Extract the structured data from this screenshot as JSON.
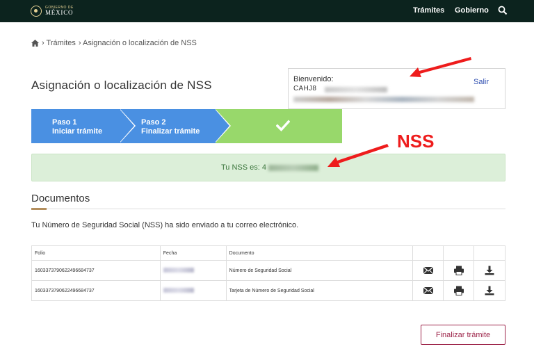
{
  "header": {
    "logo_small": "GOBIERNO DE",
    "logo_big": "MÉXICO",
    "nav": [
      {
        "label": "Trámites"
      },
      {
        "label": "Gobierno"
      }
    ],
    "search_icon": "search-icon",
    "background_color": "#0c231e"
  },
  "breadcrumb": {
    "home_icon": "home-icon",
    "items": [
      "› Trámites",
      "› Asignación o localización de NSS"
    ]
  },
  "page": {
    "title": "Asignación o localización de NSS"
  },
  "welcome": {
    "label": "Bienvenido:",
    "curp_partial": "CAHJ8",
    "logout_label": "Salir"
  },
  "steps": [
    {
      "title": "Paso 1",
      "subtitle": "Iniciar trámite"
    },
    {
      "title": "Paso 2",
      "subtitle": "Finalizar trámite"
    }
  ],
  "steps_colors": {
    "active": "#4a90e2",
    "complete": "#98d86b"
  },
  "nss_alert": {
    "text": "Tu NSS es: 4"
  },
  "documents": {
    "title": "Documentos",
    "info": "Tu Número de Seguridad Social (NSS) ha sido enviado a tu correo electrónico.",
    "columns": [
      "Folio",
      "Fecha",
      "Documento"
    ],
    "rows": [
      {
        "folio": "160337379062249668473​7",
        "documento": "Número de Seguridad Social"
      },
      {
        "folio": "160337379062249668473​7",
        "documento": "Tarjeta de Número de Seguridad Social"
      }
    ],
    "action_icons": [
      "envelope-icon",
      "printer-icon",
      "download-icon"
    ]
  },
  "footer": {
    "finish_label": "Finalizar trámite",
    "accent_color": "#9d2449"
  },
  "annotation": {
    "label": "NSS",
    "color": "#ee1c1c"
  }
}
